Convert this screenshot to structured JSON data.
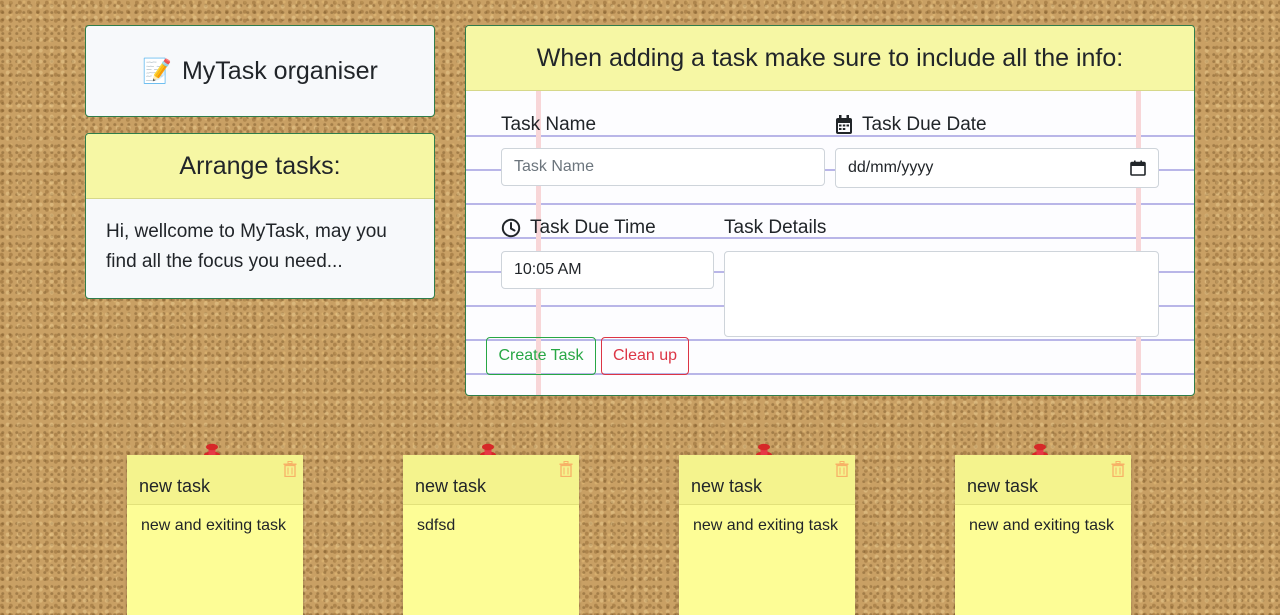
{
  "app": {
    "emoji": "📝",
    "title": "MyTask organiser"
  },
  "arrange": {
    "title": "Arrange tasks:",
    "welcome": "Hi, wellcome to MyTask, may you find all the focus you need..."
  },
  "form": {
    "heading": "When adding a task make sure to include all the info:",
    "task_name_label": "Task Name",
    "task_name_placeholder": "Task Name",
    "due_date_label": "Task Due Date",
    "due_date_placeholder": "dd/mm/yyyy",
    "due_time_label": "Task Due Time",
    "due_time_value": "10:05 AM",
    "details_label": "Task Details",
    "details_value": "",
    "create_label": "Create Task",
    "cleanup_label": "Clean up"
  },
  "notes": [
    {
      "title": "new task",
      "text": "new and exiting task"
    },
    {
      "title": "new task",
      "text": "sdfsd"
    },
    {
      "title": "new task",
      "text": "new and exiting task"
    },
    {
      "title": "new task",
      "text": "new and exiting task"
    }
  ],
  "colors": {
    "header_yellow": "#f6f7a4",
    "note_yellow": "#fdfd96",
    "create_green": "#28a745",
    "cleanup_red": "#dc3545",
    "card_border": "#2f7d4a"
  },
  "icons": {
    "title": "memo-icon",
    "date": "calendar-icon",
    "time": "clock-icon",
    "note_pin": "pushpin-icon",
    "note_delete": "trash-icon"
  }
}
